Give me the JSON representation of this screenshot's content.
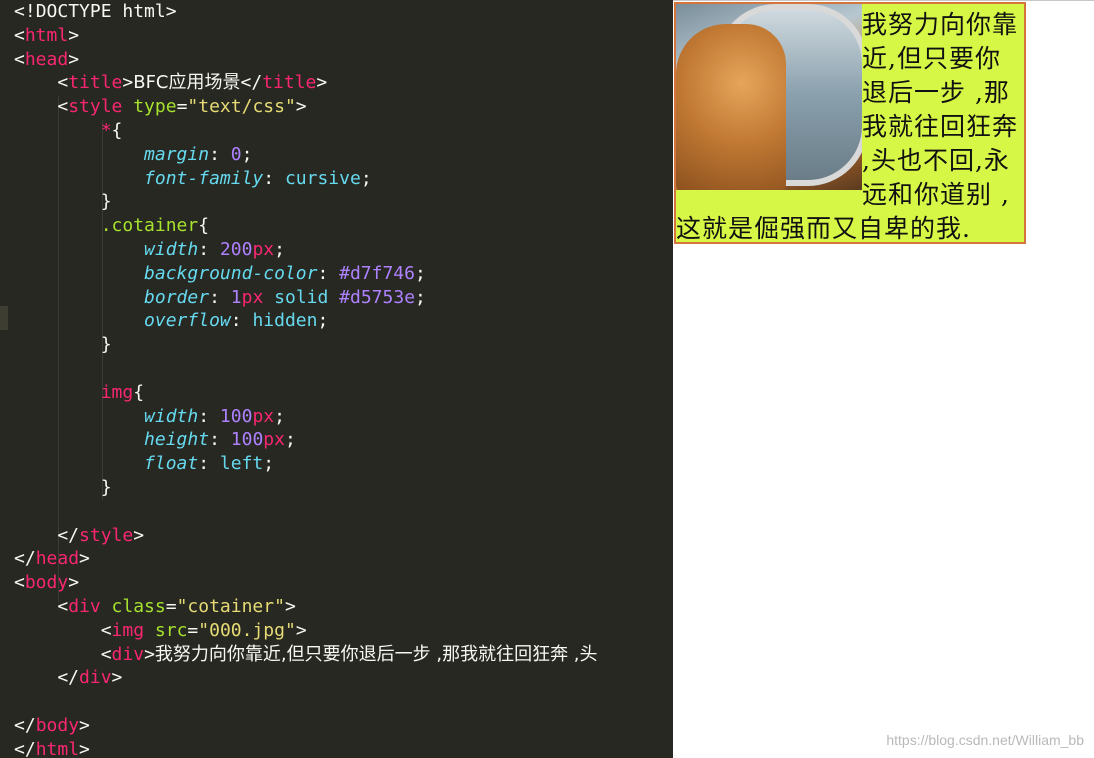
{
  "editor": {
    "lines": [
      [
        [
          "p",
          "<!"
        ],
        [
          "d",
          "DOCTYPE"
        ],
        [
          "p",
          " html>"
        ]
      ],
      [
        [
          "p",
          "<"
        ],
        [
          "t",
          "html"
        ],
        [
          "p",
          ">"
        ]
      ],
      [
        [
          "p",
          "<"
        ],
        [
          "t",
          "head"
        ],
        [
          "p",
          ">"
        ]
      ],
      [
        [
          "p",
          "    <"
        ],
        [
          "t",
          "title"
        ],
        [
          "p",
          ">"
        ],
        [
          "x",
          "BFC应用场景"
        ],
        [
          "p",
          "</"
        ],
        [
          "t",
          "title"
        ],
        [
          "p",
          ">"
        ]
      ],
      [
        [
          "p",
          "    <"
        ],
        [
          "t",
          "style"
        ],
        [
          "p",
          " "
        ],
        [
          "a",
          "type"
        ],
        [
          "p",
          "="
        ],
        [
          "s",
          "\"text/css\""
        ],
        [
          "p",
          ">"
        ]
      ],
      [
        [
          "p",
          "        "
        ],
        [
          "t",
          "*"
        ],
        [
          "p",
          "{"
        ]
      ],
      [
        [
          "p",
          "            "
        ],
        [
          "pr",
          "margin"
        ],
        [
          "p",
          ": "
        ],
        [
          "n",
          "0"
        ],
        [
          "p",
          ";"
        ]
      ],
      [
        [
          "p",
          "            "
        ],
        [
          "pr",
          "font-family"
        ],
        [
          "p",
          ": "
        ],
        [
          "v",
          "cursive"
        ],
        [
          "p",
          ";"
        ]
      ],
      [
        [
          "p",
          "        }"
        ]
      ],
      [
        [
          "p",
          "        "
        ],
        [
          "a",
          ".cotainer"
        ],
        [
          "p",
          "{"
        ]
      ],
      [
        [
          "p",
          "            "
        ],
        [
          "pr",
          "width"
        ],
        [
          "p",
          ": "
        ],
        [
          "n",
          "200"
        ],
        [
          "u",
          "px"
        ],
        [
          "p",
          ";"
        ]
      ],
      [
        [
          "p",
          "            "
        ],
        [
          "pr",
          "background-color"
        ],
        [
          "p",
          ": "
        ],
        [
          "n",
          "#d7f746"
        ],
        [
          "p",
          ";"
        ]
      ],
      [
        [
          "p",
          "            "
        ],
        [
          "pr",
          "border"
        ],
        [
          "p",
          ": "
        ],
        [
          "n",
          "1"
        ],
        [
          "u",
          "px"
        ],
        [
          "p",
          " "
        ],
        [
          "v",
          "solid"
        ],
        [
          "p",
          " "
        ],
        [
          "n",
          "#d5753e"
        ],
        [
          "p",
          ";"
        ]
      ],
      [
        [
          "p",
          "            "
        ],
        [
          "pr",
          "overflow"
        ],
        [
          "p",
          ": "
        ],
        [
          "v",
          "hidden"
        ],
        [
          "p",
          ";"
        ]
      ],
      [
        [
          "p",
          "        }"
        ]
      ],
      [
        [
          "p",
          ""
        ]
      ],
      [
        [
          "p",
          "        "
        ],
        [
          "t",
          "img"
        ],
        [
          "p",
          "{"
        ]
      ],
      [
        [
          "p",
          "            "
        ],
        [
          "pr",
          "width"
        ],
        [
          "p",
          ": "
        ],
        [
          "n",
          "100"
        ],
        [
          "u",
          "px"
        ],
        [
          "p",
          ";"
        ]
      ],
      [
        [
          "p",
          "            "
        ],
        [
          "pr",
          "height"
        ],
        [
          "p",
          ": "
        ],
        [
          "n",
          "100"
        ],
        [
          "u",
          "px"
        ],
        [
          "p",
          ";"
        ]
      ],
      [
        [
          "p",
          "            "
        ],
        [
          "pr",
          "float"
        ],
        [
          "p",
          ": "
        ],
        [
          "v",
          "left"
        ],
        [
          "p",
          ";"
        ]
      ],
      [
        [
          "p",
          "        }"
        ]
      ],
      [
        [
          "p",
          ""
        ]
      ],
      [
        [
          "p",
          "    </"
        ],
        [
          "t",
          "style"
        ],
        [
          "p",
          ">"
        ]
      ],
      [
        [
          "p",
          "</"
        ],
        [
          "t",
          "head"
        ],
        [
          "p",
          ">"
        ]
      ],
      [
        [
          "p",
          "<"
        ],
        [
          "t",
          "body"
        ],
        [
          "p",
          ">"
        ]
      ],
      [
        [
          "p",
          "    <"
        ],
        [
          "t",
          "div"
        ],
        [
          "p",
          " "
        ],
        [
          "a",
          "class"
        ],
        [
          "p",
          "="
        ],
        [
          "s",
          "\"cotainer\""
        ],
        [
          "p",
          ">"
        ]
      ],
      [
        [
          "p",
          "        <"
        ],
        [
          "t",
          "img"
        ],
        [
          "p",
          " "
        ],
        [
          "a",
          "src"
        ],
        [
          "p",
          "="
        ],
        [
          "s",
          "\"000.jpg\""
        ],
        [
          "p",
          ">"
        ]
      ],
      [
        [
          "p",
          "        <"
        ],
        [
          "t",
          "div"
        ],
        [
          "p",
          ">"
        ],
        [
          "x",
          "我努力向你靠近,但只要你退后一步 ,那我就往回狂奔 ,头"
        ]
      ],
      [
        [
          "p",
          "    </"
        ],
        [
          "t",
          "div"
        ],
        [
          "p",
          ">"
        ]
      ],
      [
        [
          "p",
          ""
        ]
      ],
      [
        [
          "p",
          "</"
        ],
        [
          "t",
          "body"
        ],
        [
          "p",
          ">"
        ]
      ],
      [
        [
          "p",
          "</"
        ],
        [
          "t",
          "html"
        ],
        [
          "p",
          ">"
        ]
      ]
    ]
  },
  "preview": {
    "poem": "我努力向你靠近,但只要你退后一步 ,那我就往回狂奔 ,头也不回,永远和你道别 ,这就是倔强而又自卑的我.",
    "watermark": "https://blog.csdn.net/William_bb",
    "colors": {
      "background": "#d7f746",
      "border": "#d5753e"
    }
  }
}
